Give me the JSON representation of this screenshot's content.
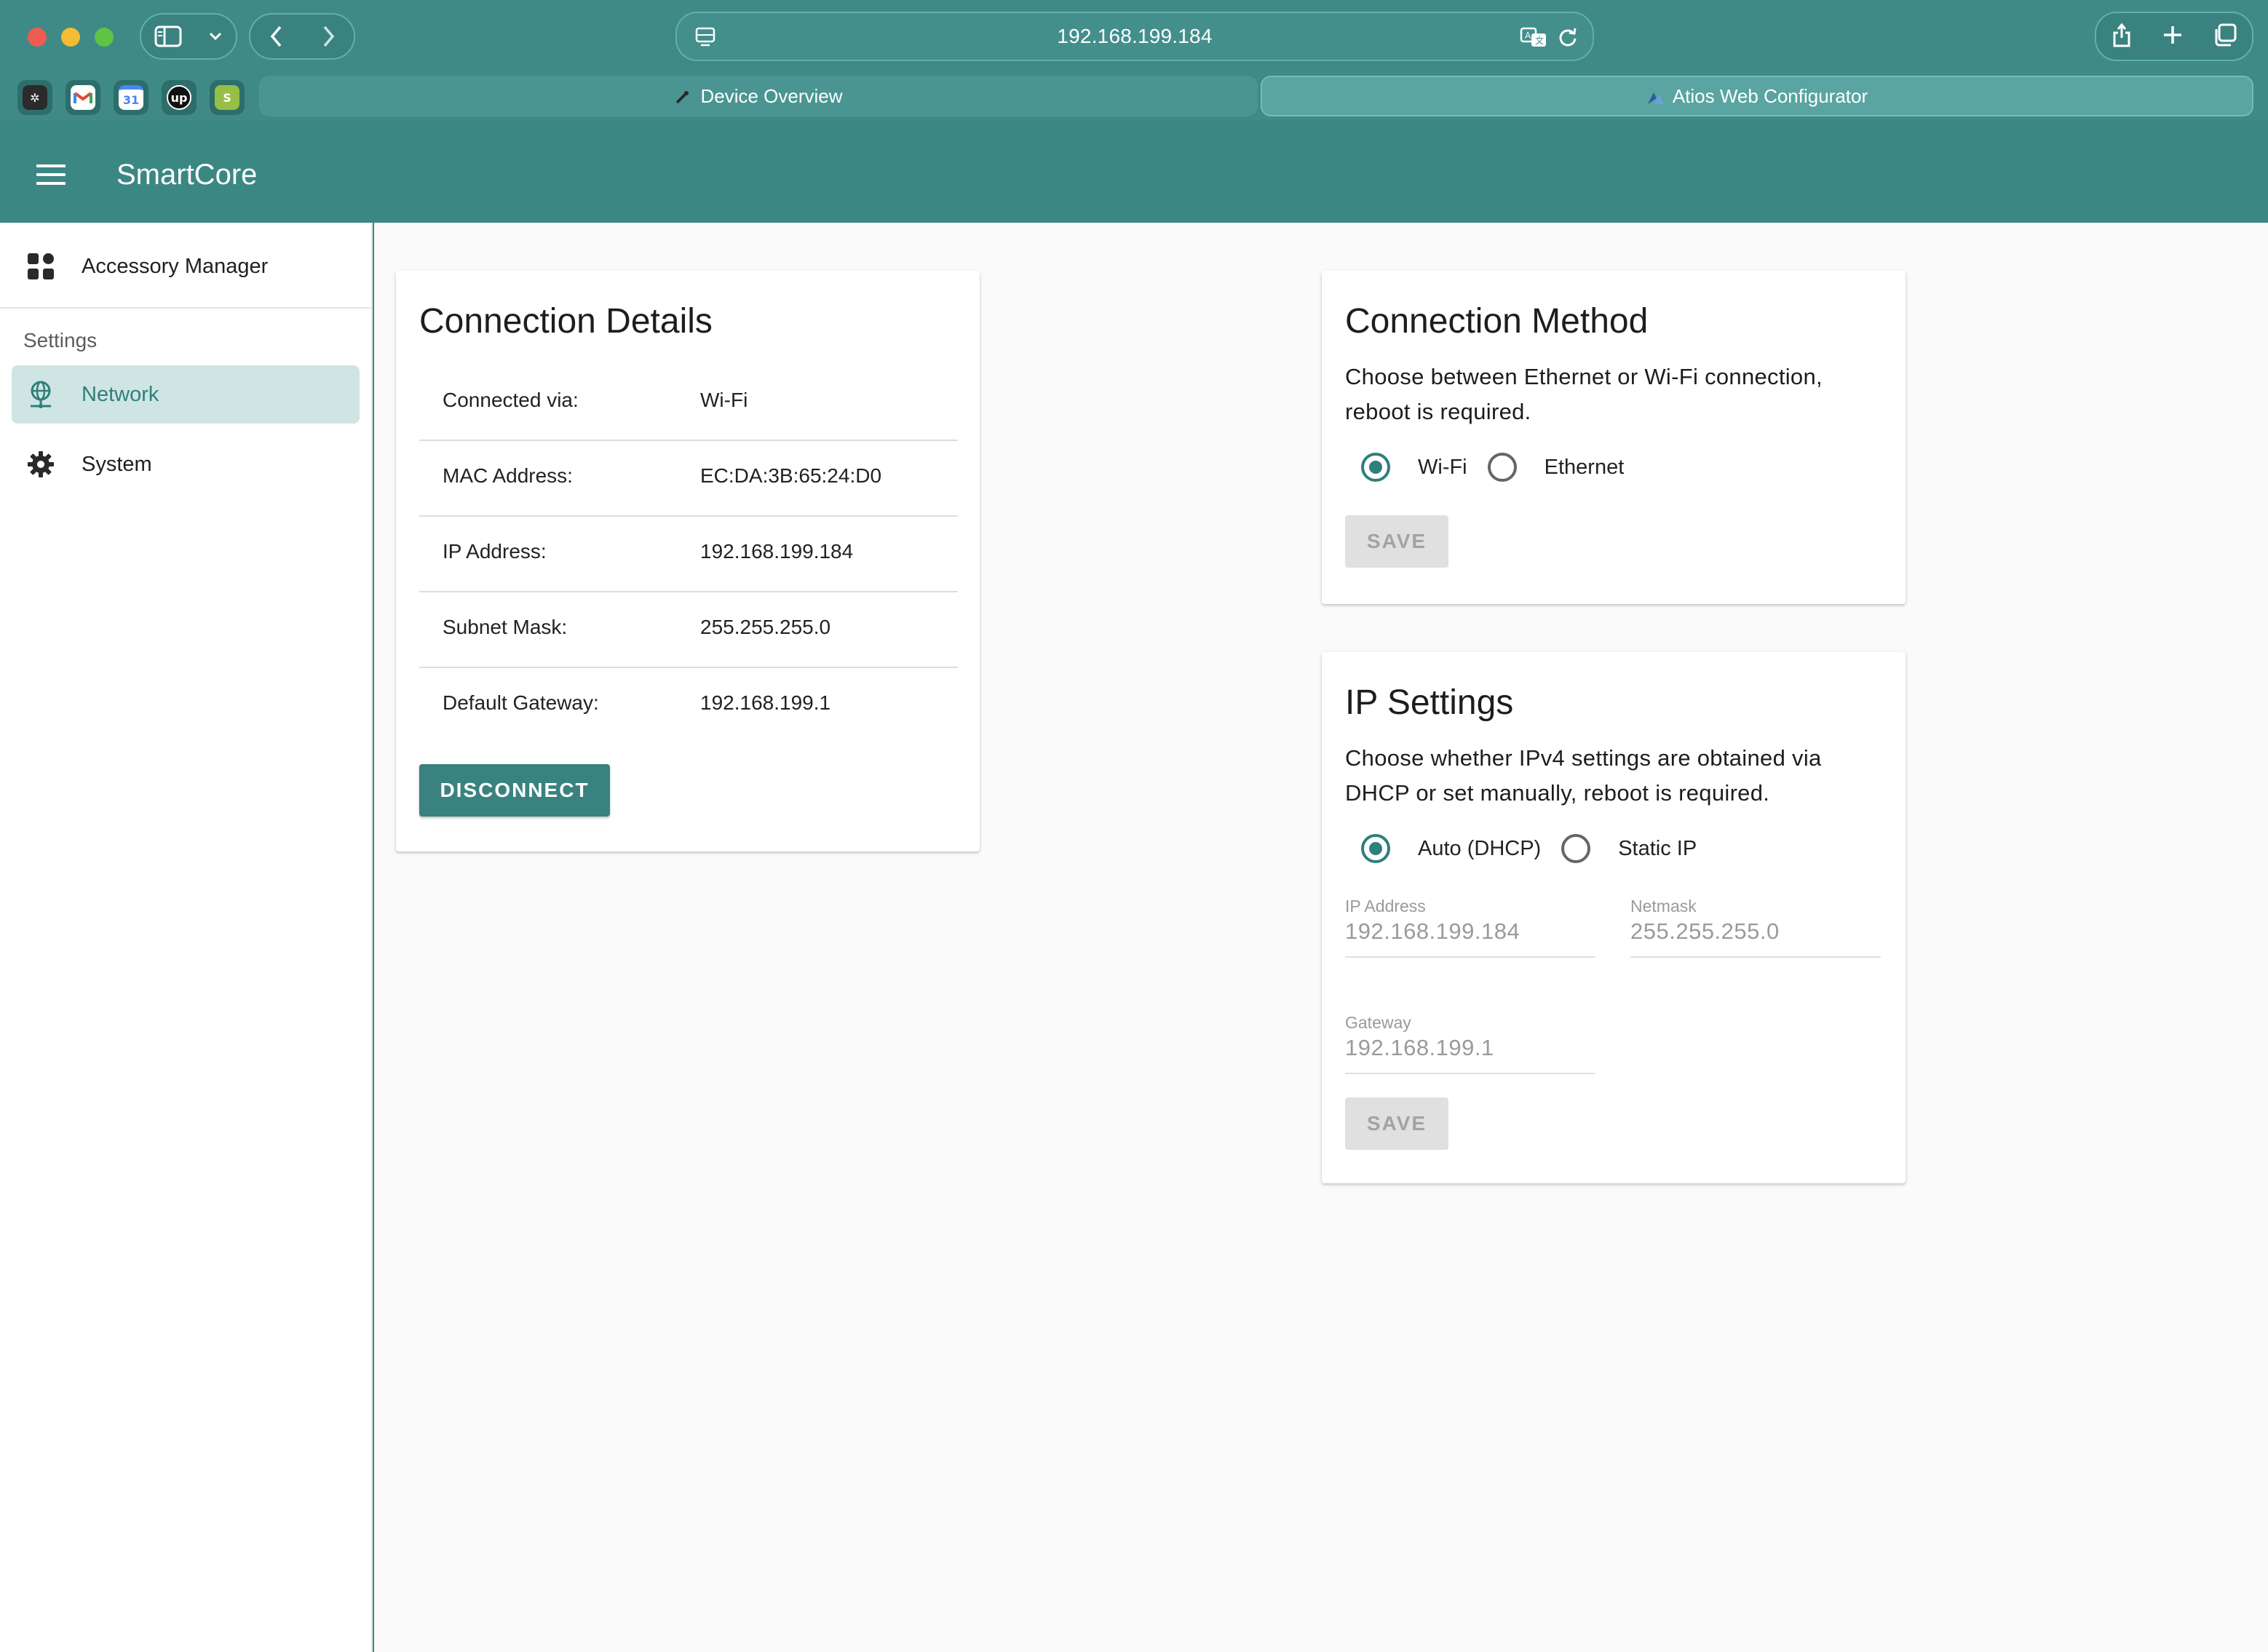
{
  "browser": {
    "url": "192.168.199.184",
    "tabs": [
      {
        "label": "Device Overview"
      },
      {
        "label": "Atios Web Configurator"
      }
    ],
    "favorites": [
      {
        "icon": "puzzle-app-icon",
        "color": "#2b2b2b"
      },
      {
        "icon": "gmail-icon",
        "color": "#ffffff"
      },
      {
        "icon": "calendar-icon",
        "color": "#4a86f0",
        "text": "31"
      },
      {
        "icon": "upwork-icon",
        "color": "#111111",
        "text": "up"
      },
      {
        "icon": "shopify-icon",
        "color": "#95bf47",
        "text": "S"
      }
    ]
  },
  "app": {
    "title": "SmartCore"
  },
  "sidebar": {
    "top_item": {
      "label": "Accessory Manager",
      "icon": "dashboard-icon"
    },
    "section_header": "Settings",
    "items": [
      {
        "label": "Network",
        "icon": "network-icon",
        "active": true
      },
      {
        "label": "System",
        "icon": "gear-icon",
        "active": false
      }
    ]
  },
  "connection_details": {
    "title": "Connection Details",
    "rows": [
      {
        "label": "Connected via:",
        "value": "Wi-Fi"
      },
      {
        "label": "MAC Address:",
        "value": "EC:DA:3B:65:24:D0"
      },
      {
        "label": "IP Address:",
        "value": "192.168.199.184"
      },
      {
        "label": "Subnet Mask:",
        "value": "255.255.255.0"
      },
      {
        "label": "Default Gateway:",
        "value": "192.168.199.1"
      }
    ],
    "disconnect_label": "DISCONNECT"
  },
  "connection_method": {
    "title": "Connection Method",
    "description": "Choose between Ethernet or Wi-Fi connection, reboot is required.",
    "options": [
      {
        "label": "Wi-Fi",
        "selected": true
      },
      {
        "label": "Ethernet",
        "selected": false
      }
    ],
    "save_label": "SAVE"
  },
  "ip_settings": {
    "title": "IP Settings",
    "description": "Choose whether IPv4 settings are obtained via DHCP or set manually, reboot is required.",
    "options": [
      {
        "label": "Auto (DHCP)",
        "selected": true
      },
      {
        "label": "Static IP",
        "selected": false
      }
    ],
    "fields": {
      "ip_address": {
        "label": "IP Address",
        "value": "192.168.199.184"
      },
      "netmask": {
        "label": "Netmask",
        "value": "255.255.255.0"
      },
      "gateway": {
        "label": "Gateway",
        "value": "192.168.199.1"
      }
    },
    "save_label": "SAVE"
  },
  "colors": {
    "primary": "#3a827f",
    "accent": "#2f7f7b",
    "appbar": "#3b8784"
  }
}
